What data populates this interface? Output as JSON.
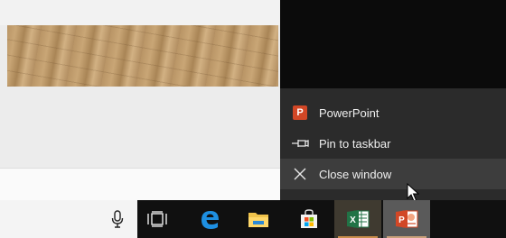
{
  "jump_list": {
    "app_name": "PowerPoint",
    "pin_label": "Pin to taskbar",
    "close_label": "Close window"
  },
  "colors": {
    "jump_list_bg": "#2b2b2b",
    "hover_bg": "#3d3d3d",
    "powerpoint": "#d24726",
    "excel": "#217346",
    "edge": "#0078d7",
    "taskbar": "#101010"
  },
  "taskbar": {
    "icons": [
      "microphone-icon",
      "task-view-icon",
      "edge-icon",
      "file-explorer-icon",
      "store-icon",
      "excel-icon",
      "powerpoint-icon"
    ],
    "excel_glyph": "X",
    "ppt_glyph": "P"
  }
}
